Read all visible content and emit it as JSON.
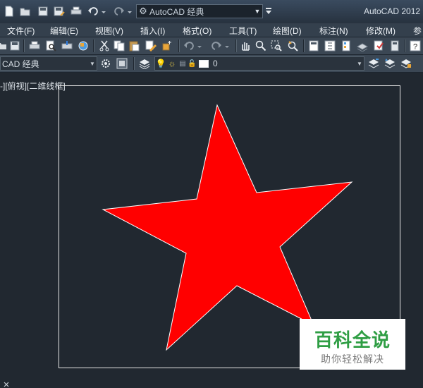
{
  "title_bar": {
    "workspace": {
      "value": "AutoCAD 经典",
      "icon": "gear-icon"
    },
    "app_title": "AutoCAD 2012",
    "quick_access": [
      "new-icon",
      "open-icon",
      "save-icon",
      "saveas-icon",
      "print-icon",
      "undo-icon",
      "redo-icon"
    ]
  },
  "menu": {
    "items": [
      "文件(F)",
      "编辑(E)",
      "视图(V)",
      "插入(I)",
      "格式(O)",
      "工具(T)",
      "绘图(D)",
      "标注(N)",
      "修改(M)",
      "参"
    ]
  },
  "toolbar2": {
    "workspace_combo": "CAD 经典",
    "layer_combo": "0"
  },
  "viewport": {
    "label": "-][俯视][二维线框]"
  },
  "drawing": {
    "shape": "star",
    "fill": "#ff0000",
    "stroke": "#ffffff"
  },
  "watermark": {
    "title": "百科全说",
    "subtitle": "助你轻松解决"
  },
  "colors": {
    "background": "#212830",
    "toolbar": "#3b4754",
    "menu": "#34404d",
    "brand_green": "#2f9e44"
  }
}
